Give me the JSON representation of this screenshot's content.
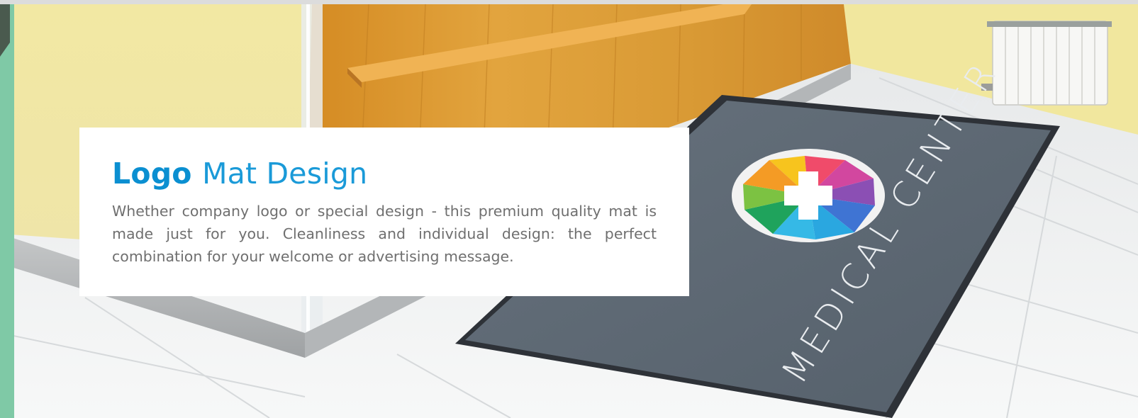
{
  "card": {
    "title_bold": "Logo",
    "title_rest": "Mat Design",
    "body": "Whether company logo or special design - this premium quality mat is made just for you. Cleanliness and individual design: the perfect combination for your welcome or advertising message."
  },
  "mat": {
    "text": "MEDICAL CENTER"
  },
  "colors": {
    "accent": "#0b8fd1",
    "mat": "#5e6a76",
    "wall": "#f3e9a8",
    "wood": "#d8962e"
  }
}
